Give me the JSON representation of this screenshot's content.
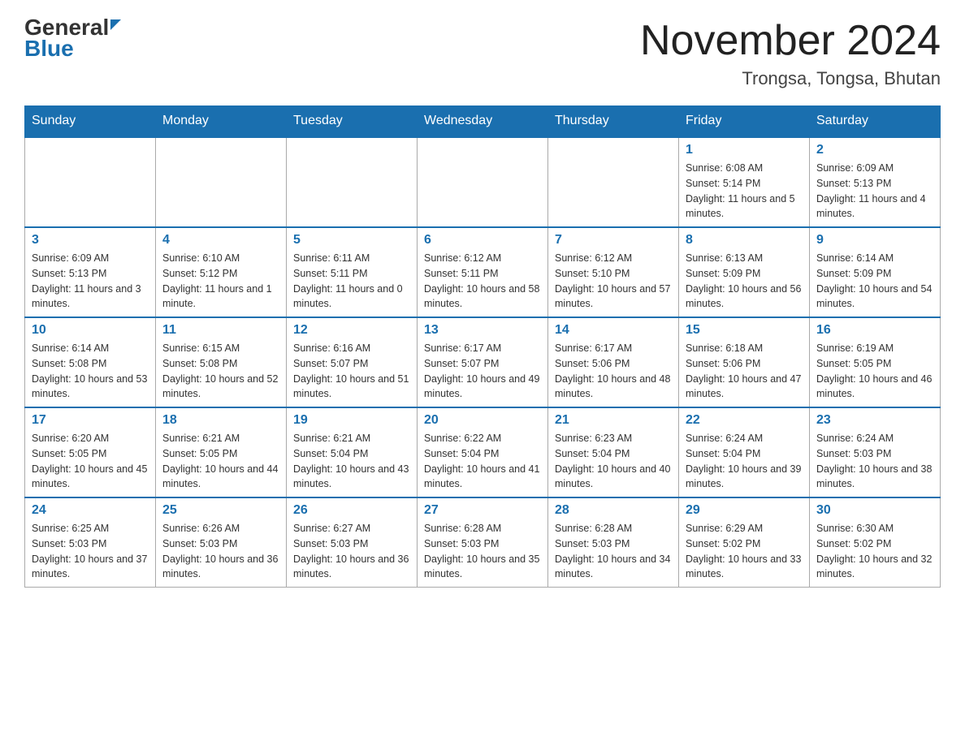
{
  "header": {
    "logo_line1": "General",
    "logo_line2": "Blue",
    "month_title": "November 2024",
    "location": "Trongsa, Tongsa, Bhutan"
  },
  "days_of_week": [
    "Sunday",
    "Monday",
    "Tuesday",
    "Wednesday",
    "Thursday",
    "Friday",
    "Saturday"
  ],
  "weeks": [
    [
      {
        "day": "",
        "info": ""
      },
      {
        "day": "",
        "info": ""
      },
      {
        "day": "",
        "info": ""
      },
      {
        "day": "",
        "info": ""
      },
      {
        "day": "",
        "info": ""
      },
      {
        "day": "1",
        "info": "Sunrise: 6:08 AM\nSunset: 5:14 PM\nDaylight: 11 hours and 5 minutes."
      },
      {
        "day": "2",
        "info": "Sunrise: 6:09 AM\nSunset: 5:13 PM\nDaylight: 11 hours and 4 minutes."
      }
    ],
    [
      {
        "day": "3",
        "info": "Sunrise: 6:09 AM\nSunset: 5:13 PM\nDaylight: 11 hours and 3 minutes."
      },
      {
        "day": "4",
        "info": "Sunrise: 6:10 AM\nSunset: 5:12 PM\nDaylight: 11 hours and 1 minute."
      },
      {
        "day": "5",
        "info": "Sunrise: 6:11 AM\nSunset: 5:11 PM\nDaylight: 11 hours and 0 minutes."
      },
      {
        "day": "6",
        "info": "Sunrise: 6:12 AM\nSunset: 5:11 PM\nDaylight: 10 hours and 58 minutes."
      },
      {
        "day": "7",
        "info": "Sunrise: 6:12 AM\nSunset: 5:10 PM\nDaylight: 10 hours and 57 minutes."
      },
      {
        "day": "8",
        "info": "Sunrise: 6:13 AM\nSunset: 5:09 PM\nDaylight: 10 hours and 56 minutes."
      },
      {
        "day": "9",
        "info": "Sunrise: 6:14 AM\nSunset: 5:09 PM\nDaylight: 10 hours and 54 minutes."
      }
    ],
    [
      {
        "day": "10",
        "info": "Sunrise: 6:14 AM\nSunset: 5:08 PM\nDaylight: 10 hours and 53 minutes."
      },
      {
        "day": "11",
        "info": "Sunrise: 6:15 AM\nSunset: 5:08 PM\nDaylight: 10 hours and 52 minutes."
      },
      {
        "day": "12",
        "info": "Sunrise: 6:16 AM\nSunset: 5:07 PM\nDaylight: 10 hours and 51 minutes."
      },
      {
        "day": "13",
        "info": "Sunrise: 6:17 AM\nSunset: 5:07 PM\nDaylight: 10 hours and 49 minutes."
      },
      {
        "day": "14",
        "info": "Sunrise: 6:17 AM\nSunset: 5:06 PM\nDaylight: 10 hours and 48 minutes."
      },
      {
        "day": "15",
        "info": "Sunrise: 6:18 AM\nSunset: 5:06 PM\nDaylight: 10 hours and 47 minutes."
      },
      {
        "day": "16",
        "info": "Sunrise: 6:19 AM\nSunset: 5:05 PM\nDaylight: 10 hours and 46 minutes."
      }
    ],
    [
      {
        "day": "17",
        "info": "Sunrise: 6:20 AM\nSunset: 5:05 PM\nDaylight: 10 hours and 45 minutes."
      },
      {
        "day": "18",
        "info": "Sunrise: 6:21 AM\nSunset: 5:05 PM\nDaylight: 10 hours and 44 minutes."
      },
      {
        "day": "19",
        "info": "Sunrise: 6:21 AM\nSunset: 5:04 PM\nDaylight: 10 hours and 43 minutes."
      },
      {
        "day": "20",
        "info": "Sunrise: 6:22 AM\nSunset: 5:04 PM\nDaylight: 10 hours and 41 minutes."
      },
      {
        "day": "21",
        "info": "Sunrise: 6:23 AM\nSunset: 5:04 PM\nDaylight: 10 hours and 40 minutes."
      },
      {
        "day": "22",
        "info": "Sunrise: 6:24 AM\nSunset: 5:04 PM\nDaylight: 10 hours and 39 minutes."
      },
      {
        "day": "23",
        "info": "Sunrise: 6:24 AM\nSunset: 5:03 PM\nDaylight: 10 hours and 38 minutes."
      }
    ],
    [
      {
        "day": "24",
        "info": "Sunrise: 6:25 AM\nSunset: 5:03 PM\nDaylight: 10 hours and 37 minutes."
      },
      {
        "day": "25",
        "info": "Sunrise: 6:26 AM\nSunset: 5:03 PM\nDaylight: 10 hours and 36 minutes."
      },
      {
        "day": "26",
        "info": "Sunrise: 6:27 AM\nSunset: 5:03 PM\nDaylight: 10 hours and 36 minutes."
      },
      {
        "day": "27",
        "info": "Sunrise: 6:28 AM\nSunset: 5:03 PM\nDaylight: 10 hours and 35 minutes."
      },
      {
        "day": "28",
        "info": "Sunrise: 6:28 AM\nSunset: 5:03 PM\nDaylight: 10 hours and 34 minutes."
      },
      {
        "day": "29",
        "info": "Sunrise: 6:29 AM\nSunset: 5:02 PM\nDaylight: 10 hours and 33 minutes."
      },
      {
        "day": "30",
        "info": "Sunrise: 6:30 AM\nSunset: 5:02 PM\nDaylight: 10 hours and 32 minutes."
      }
    ]
  ]
}
